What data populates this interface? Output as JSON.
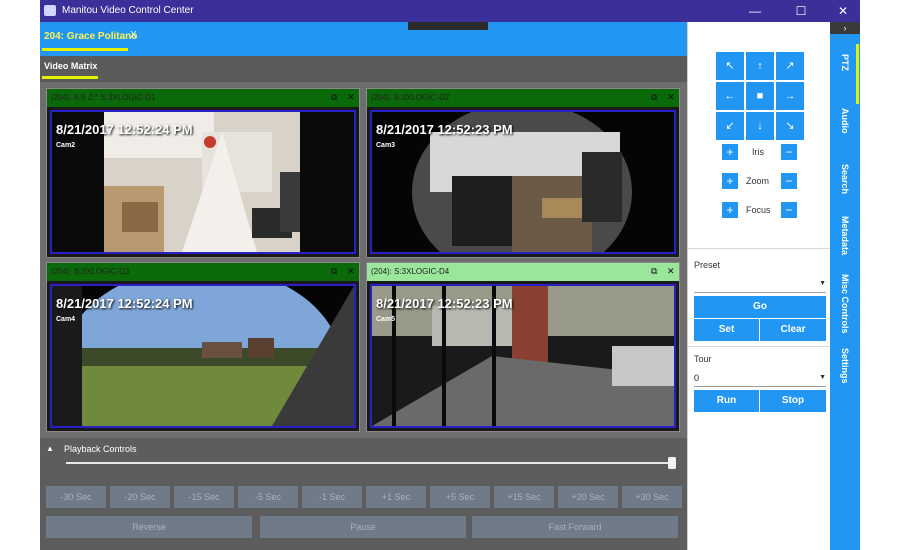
{
  "window": {
    "title": "Manitou Video Control Center",
    "min_glyph": "—",
    "max_glyph": "☐",
    "close_glyph": "✕"
  },
  "tabs": [
    {
      "label": "204: Grace Politano",
      "close": "X"
    }
  ],
  "subtabs": [
    {
      "label": "Video Matrix"
    }
  ],
  "matrix": {
    "cells": [
      {
        "header": "(204): A:5 Z:* S:3XLOGIC-D1",
        "timestamp": "8/21/2017 12:52:24 PM",
        "cam": "Cam2"
      },
      {
        "header": "(204): S:3XLOGIC-D2",
        "timestamp": "8/21/2017 12:52:23 PM",
        "cam": "Cam3"
      },
      {
        "header": "(204): S:3XLOGIC-D3",
        "timestamp": "8/21/2017 12:52:24 PM",
        "cam": "Cam4"
      },
      {
        "header": "(204): S:3XLOGIC-D4",
        "timestamp": "8/21/2017 12:52:23 PM",
        "cam": "Cam5"
      }
    ],
    "popout_glyph": "⧉",
    "close_glyph": "✕"
  },
  "playback": {
    "title": "Playback Controls",
    "collapse_glyph": "▲",
    "seek_buttons": [
      "-30 Sec",
      "-20 Sec",
      "-15 Sec",
      "-5 Sec",
      "-1 Sec",
      "+1 Sec",
      "+5 Sec",
      "+15 Sec",
      "+20 Sec",
      "+30 Sec"
    ],
    "mode_buttons": [
      "Reverse",
      "Pause",
      "Fast Forward"
    ],
    "slider_position": 1.0
  },
  "ptz": {
    "pad": [
      "↖",
      "↑",
      "↗",
      "←",
      "■",
      "→",
      "↙",
      "↓",
      "↘"
    ],
    "iris_label": "Iris",
    "zoom_label": "Zoom",
    "focus_label": "Focus",
    "plus_glyph": "+",
    "minus_glyph": "−",
    "preset_label": "Preset",
    "preset_value": "",
    "go_label": "Go",
    "set_label": "Set",
    "clear_label": "Clear",
    "tour_label": "Tour",
    "tour_value": "0",
    "run_label": "Run",
    "stop_label": "Stop",
    "caret_glyph": "▼"
  },
  "sidetabs": {
    "collapse_glyph": "›",
    "items": [
      "PTZ",
      "Audio",
      "Search",
      "Metadata",
      "Misc Controls",
      "Settings"
    ]
  },
  "colors": {
    "accent_blue": "#2196f3",
    "title_bar": "#3b2f9a",
    "tab_highlight": "#e3f200",
    "cell_header_green": "#0a6a0a",
    "active_header_green": "#9ae69a",
    "video_border": "#2a20c8"
  }
}
